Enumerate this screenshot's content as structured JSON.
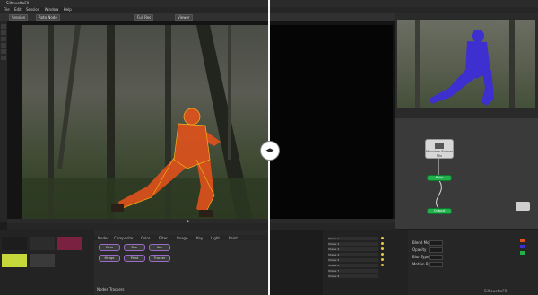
{
  "window": {
    "title": "SilhouetteFX"
  },
  "menu": [
    "File",
    "Edit",
    "Session",
    "Window",
    "Help"
  ],
  "toolbar": {
    "chips": [
      "Session",
      "Roto Node",
      "Full Res",
      "Viewer"
    ]
  },
  "viewer": {
    "frame_label": ""
  },
  "nodes": {
    "media_label": "Mountain Runner Mix",
    "green1_label": "Roto",
    "green2_label": "Output"
  },
  "node_pills": [
    "Roto",
    "Blur",
    "Key",
    "Merge",
    "Paint",
    "Tracker"
  ],
  "tabs": [
    "Nodes",
    "Composite",
    "Color",
    "Filter",
    "Image",
    "Key",
    "Light",
    "Paint"
  ],
  "objects": {
    "rows": [
      "Shape 1",
      "Shape 2",
      "Shape 3",
      "Shape 4",
      "Shape 5",
      "Shape 6",
      "Shape 7",
      "Shape 8"
    ]
  },
  "params": {
    "labels": [
      "Blend Mode",
      "Opacity",
      "Blur Type",
      "Motion Blur"
    ]
  },
  "bottom_tabs": [
    "Nodes",
    "Trackers"
  ],
  "status": "SilhouetteFX"
}
